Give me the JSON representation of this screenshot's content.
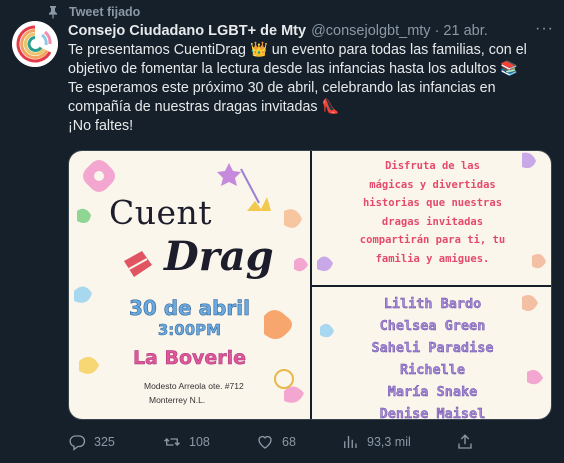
{
  "pinned": {
    "label": "Tweet fijado",
    "icon": "pin-icon"
  },
  "tweet": {
    "display_name": "Consejo Ciudadano LGBT+ de Mty",
    "handle": "@consejolgbt_mty",
    "separator": "·",
    "time": "21 abr.",
    "lines": [
      "Te presentamos CuentiDrag 👑 un evento para todas las familias, con el",
      "objetivo de fomentar la lectura desde las infancias hasta los adultos 📚",
      "Te esperamos este próximo 30 de abril, celebrando las infancias en",
      "compañía de nuestras dragas invitadas 👠",
      "¡No faltes!"
    ]
  },
  "media": {
    "poster": {
      "logo_part1": "Cuent",
      "logo_part2": "Drag",
      "date": "30 de abril",
      "time": "3:00PM",
      "venue": "La Boverie",
      "address_line1": "Modesto Arreola ote. #712",
      "address_line2": "Monterrey N.L."
    },
    "promo_lines": [
      "Disfruta de las",
      "mágicas y divertidas",
      "historias que nuestras",
      "dragas invitadas",
      "compartirán para ti, tu",
      "familia y amigues."
    ],
    "guests": [
      "Lilith Bardo",
      "Chelsea Green",
      "Saheli Paradise",
      "Richelle",
      "María Snake",
      "Denise Maisel"
    ]
  },
  "actions": {
    "replies": "325",
    "retweets": "108",
    "likes": "68",
    "views": "93,3 mil"
  },
  "colors": {
    "background": "#15202b",
    "text": "#e7e9ea",
    "muted": "#8b98a5",
    "poster_bg": "#fbf6ec",
    "date_blue": "#6aa9df",
    "venue_pink": "#e0569b",
    "promo_red": "#e44a6a",
    "guest_purple": "#a68ad8"
  }
}
